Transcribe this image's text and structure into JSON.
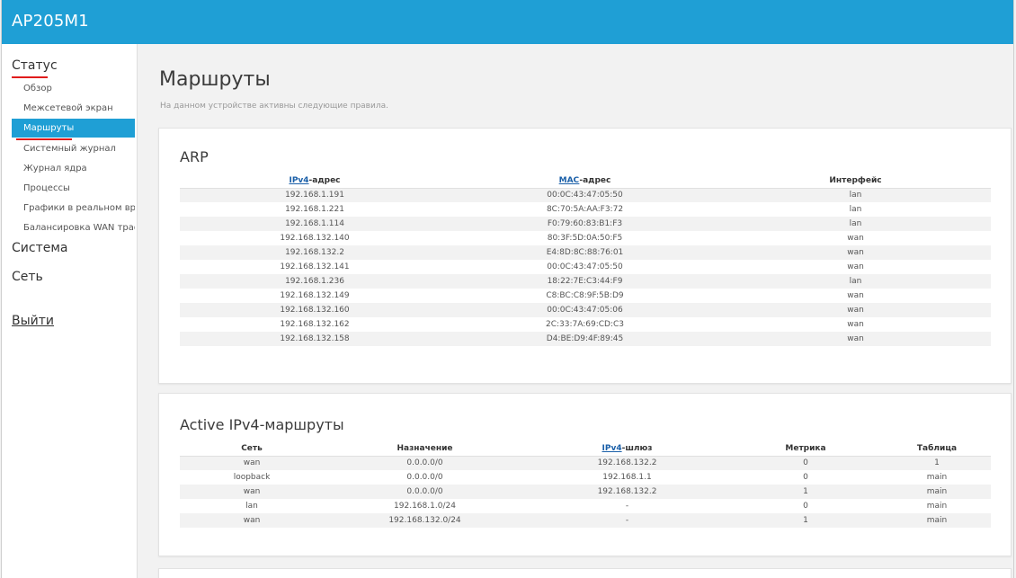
{
  "app": {
    "title": "AP205M1"
  },
  "sidebar": {
    "status": "Статус",
    "status_items": [
      {
        "label": "Обзор"
      },
      {
        "label": "Межсетевой экран"
      },
      {
        "label": "Маршруты"
      },
      {
        "label": "Системный журнал"
      },
      {
        "label": "Журнал ядра"
      },
      {
        "label": "Процессы"
      },
      {
        "label": "Графики в реальном времени"
      },
      {
        "label": "Балансировка WAN трафика"
      }
    ],
    "system": "Система",
    "network": "Сеть",
    "logout": "Выйти",
    "active_item": "Маршруты",
    "highlight_color": "#1f9fd5",
    "annotation_color": "#e01b1b"
  },
  "page": {
    "title": "Маршруты",
    "description": "На данном устройстве активны следующие правила."
  },
  "arp": {
    "title": "ARP",
    "headers": {
      "ip_abbr": "IPv4",
      "ip_rest": "-адрес",
      "mac_abbr": "MAC",
      "mac_rest": "-адрес",
      "iface": "Интерфейс"
    },
    "rows": [
      [
        "192.168.1.191",
        "00:0C:43:47:05:50",
        "lan"
      ],
      [
        "192.168.1.221",
        "8C:70:5A:AA:F3:72",
        "lan"
      ],
      [
        "192.168.1.114",
        "F0:79:60:83:B1:F3",
        "lan"
      ],
      [
        "192.168.132.140",
        "80:3F:5D:0A:50:F5",
        "wan"
      ],
      [
        "192.168.132.2",
        "E4:8D:8C:88:76:01",
        "wan"
      ],
      [
        "192.168.132.141",
        "00:0C:43:47:05:50",
        "wan"
      ],
      [
        "192.168.1.236",
        "18:22:7E:C3:44:F9",
        "lan"
      ],
      [
        "192.168.132.149",
        "C8:BC:C8:9F:5B:D9",
        "wan"
      ],
      [
        "192.168.132.160",
        "00:0C:43:47:05:06",
        "wan"
      ],
      [
        "192.168.132.162",
        "2C:33:7A:69:CD:C3",
        "wan"
      ],
      [
        "192.168.132.158",
        "D4:BE:D9:4F:89:45",
        "wan"
      ]
    ]
  },
  "routes": {
    "title": "Active IPv4-маршруты",
    "headers": {
      "network": "Сеть",
      "target": "Назначение",
      "gw_abbr": "IPv4",
      "gw_rest": "-шлюз",
      "metric": "Метрика",
      "table": "Таблица"
    },
    "rows": [
      [
        "wan",
        "0.0.0.0/0",
        "192.168.132.2",
        "0",
        "1"
      ],
      [
        "loopback",
        "0.0.0.0/0",
        "192.168.1.1",
        "0",
        "main"
      ],
      [
        "wan",
        "0.0.0.0/0",
        "192.168.132.2",
        "1",
        "main"
      ],
      [
        "lan",
        "192.168.1.0/24",
        "-",
        "0",
        "main"
      ],
      [
        "wan",
        "192.168.132.0/24",
        "-",
        "1",
        "main"
      ]
    ]
  }
}
